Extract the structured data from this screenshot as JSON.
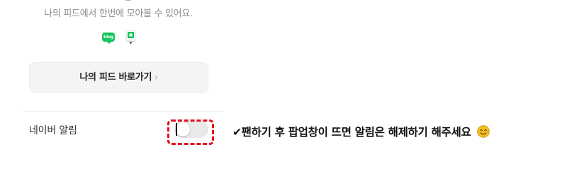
{
  "feed": {
    "description": "나의 피드에서 한번에 모아볼 수 있어요.",
    "icons": [
      "blog-icon",
      "cafe-icon"
    ],
    "blog_icon_text": "blog",
    "button_label": "나의 피드 바로가기",
    "button_chevron": "›"
  },
  "alarm": {
    "label": "네이버 알림",
    "toggle_state": "off"
  },
  "annotation": {
    "instruction": "✔팬하기 후 팝업창이 뜨면 알림은 해제하기 해주세요",
    "emoji": "smiling-face-icon",
    "highlight_color": "#e10f1f"
  },
  "colors": {
    "blog_green": "#10c55a",
    "toggle_off": "#e9e9e9",
    "button_bg": "#f4f4f4"
  }
}
